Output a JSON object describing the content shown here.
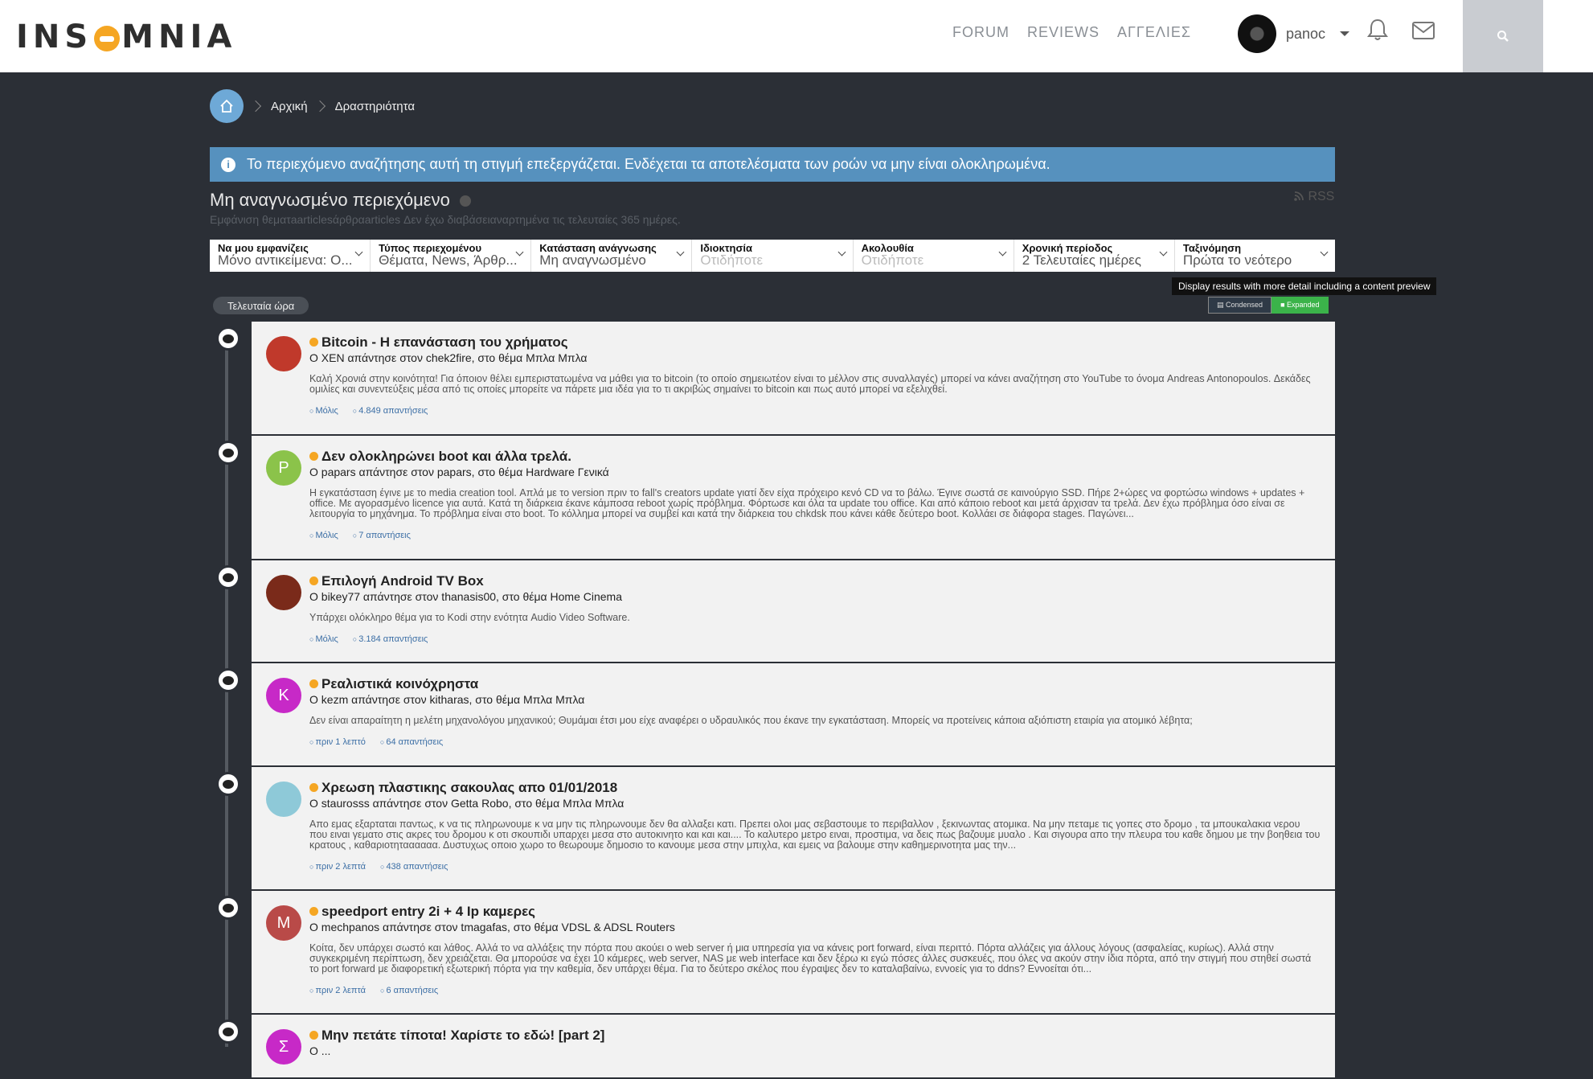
{
  "header": {
    "logo_text": [
      "INS",
      "MNIA"
    ],
    "nav": [
      "FORUM",
      "REVIEWS",
      "ΑΓΓΕΛΙΕΣ"
    ],
    "user_name": "panoc"
  },
  "breadcrumb": [
    "Αρχική",
    "Δραστηριότητα"
  ],
  "info_message": "Το περιεχόμενο αναζήτησης αυτή τη στιγμή επεξεργάζεται. Ενδέχεται τα αποτελέσματα των ροών να μην είναι ολοκληρωμένα.",
  "page": {
    "title": "Μη αναγνωσμένο περιεχόμενο",
    "rss": "RSS",
    "subtitle": "Εμφάνιση θεματaarticlesάρθραarticles Δεν έχω διαβάσειαναρτημένα τις τελευταίες 365 ημέρες."
  },
  "filters": [
    {
      "label": "Να μου εμφανίζεις",
      "value": "Μόνο αντικείμενα: O..."
    },
    {
      "label": "Τύπος περιεχομένου",
      "value": "Θέματα, News, Άρθρ..."
    },
    {
      "label": "Κατάσταση ανάγνωσης",
      "value": "Μη αναγνωσμένο"
    },
    {
      "label": "Ιδιοκτησία",
      "value": "Οτιδήποτε",
      "placeholder": true
    },
    {
      "label": "Ακολουθία",
      "value": "Οτιδήποτε",
      "placeholder": true
    },
    {
      "label": "Χρονική περίοδος",
      "value": "2 Τελευταίες ημέρες"
    },
    {
      "label": "Ταξινόμηση",
      "value": "Πρώτα το νεότερο"
    }
  ],
  "view_toggle": {
    "tooltip": "Display results with more detail including a content preview",
    "condensed": "Condensed",
    "expanded": "Expanded"
  },
  "time_label": "Τελευταία ώρα",
  "items": [
    {
      "title": "Bitcoin - Η επανάσταση του χρήματος",
      "by": "Ο XEN απάντησε στον chek2fire, στο θέμα Μπλα Μπλα",
      "excerpt": "Καλή Χρονιά στην κοινότητα! Για όποιον θέλει εμπεριστατωμένα να μάθει για το bitcoin (το οποίο σημειωτέον είναι το μέλλον στις συναλλαγές) μπορεί να κάνει αναζήτηση στο YouTube το όνομα Andreas Antonopoulos. Δεκάδες ομιλίες και συνεντεύξεις μέσα από τις οποίες μπορείτε να πάρετε μια ιδέα για το τι ακριβώς σημαίνει το bitcoin και πως αυτό μπορεί να εξελιχθεί.",
      "time": "Μόλις",
      "replies": "4.849 απαντήσεις",
      "avatar_letter": "",
      "avatar_color": "#c0392b"
    },
    {
      "title": "Δεν ολοκληρώνει boot και άλλα τρελά.",
      "by": "Ο papars απάντησε στον papars, στο θέμα Hardware Γενικά",
      "excerpt": "Η εγκατάσταση έγινε με το media creation tool. Απλά με το version πριν το fall's creators update γιατί δεν είχα πρόχειρο κενό CD να το βάλω. Έγινε σωστά σε καινούργιο SSD. Πήρε 2+ώρες να φορτώσω windows + updates + office. Με αγορασμένο licence για αυτά. Κατά τη διάρκεια έκανε κάμποσα reboot χωρίς πρόβλημα. Φόρτωσε και όλα τα update του office. Και από κάποιο reboot και μετά άρχισαν τα τρελά. Δεν έχω πρόβλημα όσο είναι σε λειτουργία το μηχάνημα. Το πρόβλημα είναι στο boot. Το κόλλημα μπορεί να συμβεί και κατά την διάρκεια του chkdsk που κάνει κάθε δεύτερο boot. Κολλάει σε διάφορα stages. Παγώνει...",
      "time": "Μόλις",
      "replies": "7 απαντήσεις",
      "avatar_letter": "P",
      "avatar_color": "#8bc34a"
    },
    {
      "title": "Επιλογή Android TV Box",
      "by": "Ο bikey77 απάντησε στον thanasis00, στο θέμα Home Cinema",
      "excerpt": "Υπάρχει ολόκληρο θέμα για το Kodi στην ενότητα Audio Video Software.",
      "time": "Μόλις",
      "replies": "3.184 απαντήσεις",
      "avatar_letter": "",
      "avatar_color": "#7a2a1a"
    },
    {
      "title": "Ρεαλιστικά κοινόχρηστα",
      "by": "Ο kezm απάντησε στον kitharas, στο θέμα Μπλα Μπλα",
      "excerpt": "Δεν είναι απαραίτητη η μελέτη μηχανολόγου μηχανικού; Θυμάμαι έτσι μου είχε αναφέρει ο υδραυλικός που έκανε την εγκατάσταση. Μπορείς να προτείνεις κάποια αξιόπιστη εταιρία για ατομικό λέβητα;",
      "time": "πριν 1 λεπτό",
      "replies": "64 απαντήσεις",
      "avatar_letter": "K",
      "avatar_color": "#c729c7"
    },
    {
      "title": "Χρεωση πλαστικης σακουλας απο 01/01/2018",
      "by": "Ο staurosss απάντησε στον Getta Robo, στο θέμα Μπλα Μπλα",
      "excerpt": "Απο εμας εξαρταται παντως, κ να τις πληρωνουμε κ να μην τις πληρωνουμε δεν θα αλλαξει κατι. Πρεπει ολοι μας σεβαστουμε το περιβαλλον , ξεκινωντας ατομικα. Να μην πεταμε τις γοπες στο δρομο , τα μπουκαλακια νερου που ειναι γεματο στις ακρες του δρομου κ οτι σκουπιδι υπαρχει μεσα στο αυτοκινητο και και και.... Το καλυτερο μετρο ειναι, προστιμα, να δεις πως βαζουμε μυαλο . Και σιγουρα απο την πλευρα του καθε δημου με την βοηθεια του κρατους , καθαριοτηταααααα. Δυστυχως οποιο χωρο το θεωρουμε δημοσιο το κανουμε μεσα στην μπιχλα, και εμεις να βαλουμε στην καθημερινοτητα μας την...",
      "time": "πριν 2 λεπτά",
      "replies": "438 απαντήσεις",
      "avatar_letter": "",
      "avatar_color": "#8ec9d8"
    },
    {
      "title": "speedport entry 2i + 4 Ip καμερες",
      "by": "Ο mechpanos απάντησε στον tmagafas, στο θέμα VDSL & ADSL Routers",
      "excerpt": "Κοίτα, δεν υπάρχει σωστό και λάθος. Αλλά το να αλλάξεις την πόρτα που ακούει ο web server ή μια υπηρεσία για να κάνεις port forward, είναι περιττό. Πόρτα αλλάζεις για άλλους λόγους (ασφαλείας, κυρίως). Αλλά στην συγκεκριμένη περίπτωση, δεν χρειάζεται. Θα μπορούσε να έχει 10 κάμερες, web server, NAS με web interface και δεν ξέρω κι εγώ πόσες άλλες συσκευές, που όλες να ακούν στην ίδια πόρτα, από την στιγμή που στηθεί σωστά το port forward με διαφορετική εξωτερική πόρτα για την καθεμία, δεν υπάρχει θέμα. Για το δεύτερο σκέλος που έγραψες δεν το καταλαβαίνω, εννοείς για το ddns? Εννοείται ότι...",
      "time": "πριν 2 λεπτά",
      "replies": "6 απαντήσεις",
      "avatar_letter": "M",
      "avatar_color": "#b94a48"
    },
    {
      "title": "Μην πετάτε τίποτα! Χαρίστε το εδώ! [part 2]",
      "by": "Ο ...",
      "excerpt": "",
      "time": "",
      "replies": "",
      "avatar_letter": "Σ",
      "avatar_color": "#c729c7"
    }
  ]
}
